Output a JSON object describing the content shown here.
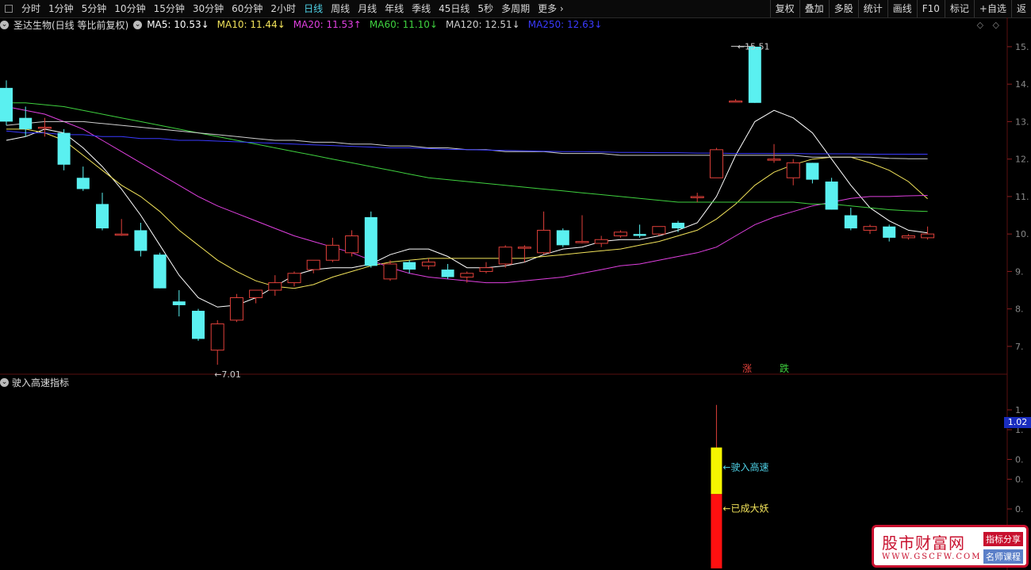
{
  "toolbar": {
    "periods": [
      {
        "label": "分时",
        "active": false
      },
      {
        "label": "1分钟",
        "active": false
      },
      {
        "label": "5分钟",
        "active": false
      },
      {
        "label": "10分钟",
        "active": false
      },
      {
        "label": "15分钟",
        "active": false
      },
      {
        "label": "30分钟",
        "active": false
      },
      {
        "label": "60分钟",
        "active": false
      },
      {
        "label": "2小时",
        "active": false
      },
      {
        "label": "日线",
        "active": true
      },
      {
        "label": "周线",
        "active": false
      },
      {
        "label": "月线",
        "active": false
      },
      {
        "label": "年线",
        "active": false
      },
      {
        "label": "季线",
        "active": false
      },
      {
        "label": "45日线",
        "active": false
      },
      {
        "label": "5秒",
        "active": false
      },
      {
        "label": "多周期",
        "active": false
      },
      {
        "label": "更多 ›",
        "active": false
      }
    ],
    "right_buttons": [
      "复权",
      "叠加",
      "多股",
      "统计",
      "画线",
      "F10",
      "标记",
      "+自选",
      "返"
    ]
  },
  "main_header": {
    "title": "圣达生物(日线 等比前复权)",
    "ma": [
      {
        "label": "MA5: 10.53↓",
        "color": "#ffffff"
      },
      {
        "label": "MA10: 11.44↓",
        "color": "#f2e35a"
      },
      {
        "label": "MA20: 11.53↑",
        "color": "#e040e0"
      },
      {
        "label": "MA60: 11.10↓",
        "color": "#3fd13f"
      },
      {
        "label": "MA120: 12.51↓",
        "color": "#cfcfcf"
      },
      {
        "label": "MA250: 12.63↓",
        "color": "#3a3aff"
      }
    ]
  },
  "price_axis": [
    "15.",
    "14.",
    "13.",
    "12.",
    "11.",
    "10.",
    "9.",
    "8.",
    "7."
  ],
  "annotations": {
    "high": "15.51",
    "low": "7.01",
    "zhang": "涨",
    "die": "跌"
  },
  "sub_header": {
    "title": "驶入高速指标"
  },
  "sub_axis": [
    "1.",
    "1.",
    "0.",
    "0.",
    "0.",
    "0."
  ],
  "sub_current": "1.02",
  "sub_labels": {
    "yellow": "驶入高速",
    "red": "已成大妖"
  },
  "colors": {
    "up": "#e0403a",
    "down": "#5af0f0",
    "ma5": "#ffffff",
    "ma10": "#f2e35a",
    "ma20": "#e040e0",
    "ma60": "#3fd13f",
    "ma120": "#cfcfcf",
    "ma250": "#3a3aff"
  },
  "watermark": {
    "name": "股市财富网",
    "url": "WWW.GSCFW.COM",
    "tag1": "指标分享",
    "tag2": "名师课程"
  },
  "chart_data": {
    "type": "candlestick",
    "candles": [
      {
        "o": 14.4,
        "h": 14.6,
        "l": 13.4,
        "c": 13.5
      },
      {
        "o": 13.6,
        "h": 13.9,
        "l": 13.1,
        "c": 13.3
      },
      {
        "o": 13.35,
        "h": 13.6,
        "l": 13.1,
        "c": 13.35
      },
      {
        "o": 13.2,
        "h": 13.3,
        "l": 12.2,
        "c": 12.35
      },
      {
        "o": 12.0,
        "h": 12.3,
        "l": 11.65,
        "c": 11.7
      },
      {
        "o": 11.3,
        "h": 11.6,
        "l": 10.6,
        "c": 10.65
      },
      {
        "o": 10.5,
        "h": 10.9,
        "l": 10.45,
        "c": 10.5
      },
      {
        "o": 10.6,
        "h": 10.8,
        "l": 9.9,
        "c": 10.05
      },
      {
        "o": 9.95,
        "h": 10.0,
        "l": 9.05,
        "c": 9.05
      },
      {
        "o": 8.7,
        "h": 9.0,
        "l": 8.3,
        "c": 8.6
      },
      {
        "o": 8.45,
        "h": 8.5,
        "l": 7.65,
        "c": 7.7
      },
      {
        "o": 7.4,
        "h": 8.2,
        "l": 7.01,
        "c": 8.1
      },
      {
        "o": 8.2,
        "h": 8.9,
        "l": 8.15,
        "c": 8.8
      },
      {
        "o": 8.8,
        "h": 9.0,
        "l": 8.65,
        "c": 9.0
      },
      {
        "o": 9.0,
        "h": 9.4,
        "l": 8.85,
        "c": 9.2
      },
      {
        "o": 9.2,
        "h": 9.5,
        "l": 9.1,
        "c": 9.45
      },
      {
        "o": 9.55,
        "h": 9.8,
        "l": 9.45,
        "c": 9.8
      },
      {
        "o": 9.8,
        "h": 10.4,
        "l": 9.75,
        "c": 10.2
      },
      {
        "o": 10.0,
        "h": 10.6,
        "l": 9.9,
        "c": 10.45
      },
      {
        "o": 10.95,
        "h": 11.1,
        "l": 9.6,
        "c": 9.65
      },
      {
        "o": 9.3,
        "h": 9.8,
        "l": 9.25,
        "c": 9.7
      },
      {
        "o": 9.75,
        "h": 9.8,
        "l": 9.45,
        "c": 9.55
      },
      {
        "o": 9.65,
        "h": 9.85,
        "l": 9.55,
        "c": 9.75
      },
      {
        "o": 9.55,
        "h": 9.7,
        "l": 9.3,
        "c": 9.35
      },
      {
        "o": 9.35,
        "h": 9.5,
        "l": 9.2,
        "c": 9.45
      },
      {
        "o": 9.5,
        "h": 9.75,
        "l": 9.45,
        "c": 9.6
      },
      {
        "o": 9.7,
        "h": 10.2,
        "l": 9.6,
        "c": 10.15
      },
      {
        "o": 10.15,
        "h": 10.2,
        "l": 9.75,
        "c": 10.15
      },
      {
        "o": 10.0,
        "h": 11.1,
        "l": 9.95,
        "c": 10.6
      },
      {
        "o": 10.6,
        "h": 10.65,
        "l": 10.15,
        "c": 10.2
      },
      {
        "o": 10.3,
        "h": 11.0,
        "l": 10.25,
        "c": 10.3
      },
      {
        "o": 10.25,
        "h": 10.45,
        "l": 10.15,
        "c": 10.35
      },
      {
        "o": 10.45,
        "h": 10.6,
        "l": 10.4,
        "c": 10.55
      },
      {
        "o": 10.5,
        "h": 10.75,
        "l": 10.4,
        "c": 10.45
      },
      {
        "o": 10.5,
        "h": 10.7,
        "l": 10.45,
        "c": 10.7
      },
      {
        "o": 10.8,
        "h": 10.85,
        "l": 10.55,
        "c": 10.65
      },
      {
        "o": 11.5,
        "h": 11.6,
        "l": 11.35,
        "c": 11.5
      },
      {
        "o": 12.0,
        "h": 12.8,
        "l": 12.0,
        "c": 12.75
      },
      {
        "o": 14.05,
        "h": 14.1,
        "l": 14.05,
        "c": 14.05
      },
      {
        "o": 15.5,
        "h": 15.51,
        "l": 14.0,
        "c": 14.0
      },
      {
        "o": 12.5,
        "h": 12.9,
        "l": 12.4,
        "c": 12.5
      },
      {
        "o": 12.0,
        "h": 12.5,
        "l": 11.8,
        "c": 12.4
      },
      {
        "o": 12.4,
        "h": 12.4,
        "l": 11.85,
        "c": 11.95
      },
      {
        "o": 11.9,
        "h": 12.0,
        "l": 11.15,
        "c": 11.15
      },
      {
        "o": 11.0,
        "h": 11.2,
        "l": 10.6,
        "c": 10.65
      },
      {
        "o": 10.6,
        "h": 10.75,
        "l": 10.5,
        "c": 10.7
      },
      {
        "o": 10.7,
        "h": 10.75,
        "l": 10.3,
        "c": 10.4
      },
      {
        "o": 10.4,
        "h": 10.5,
        "l": 10.35,
        "c": 10.45
      },
      {
        "o": 10.4,
        "h": 10.7,
        "l": 10.35,
        "c": 10.5
      }
    ],
    "ma_series": [
      {
        "name": "MA5",
        "values": [
          13.0,
          13.1,
          13.3,
          13.2,
          12.8,
          12.3,
          11.7,
          11.0,
          10.2,
          9.4,
          8.8,
          8.55,
          8.6,
          8.8,
          9.1,
          9.4,
          9.55,
          9.6,
          9.6,
          9.7,
          9.95,
          10.1,
          10.1,
          9.9,
          9.6,
          9.6,
          9.65,
          9.75,
          9.95,
          10.1,
          10.15,
          10.3,
          10.35,
          10.35,
          10.45,
          10.6,
          10.8,
          11.5,
          12.6,
          13.5,
          13.8,
          13.6,
          13.2,
          12.5,
          11.8,
          11.2,
          10.85,
          10.6,
          10.53
        ]
      },
      {
        "name": "MA10",
        "values": [
          13.3,
          13.3,
          13.2,
          13.0,
          12.6,
          12.2,
          11.8,
          11.5,
          11.1,
          10.6,
          10.2,
          9.8,
          9.5,
          9.25,
          9.1,
          9.05,
          9.15,
          9.35,
          9.5,
          9.65,
          9.75,
          9.8,
          9.85,
          9.85,
          9.85,
          9.85,
          9.85,
          9.85,
          9.9,
          9.95,
          10.0,
          10.05,
          10.1,
          10.2,
          10.3,
          10.45,
          10.6,
          10.9,
          11.3,
          11.8,
          12.15,
          12.35,
          12.5,
          12.55,
          12.55,
          12.4,
          12.2,
          11.9,
          11.44
        ]
      },
      {
        "name": "MA20",
        "values": [
          13.9,
          13.8,
          13.7,
          13.5,
          13.3,
          13.0,
          12.7,
          12.4,
          12.1,
          11.8,
          11.5,
          11.25,
          11.05,
          10.85,
          10.65,
          10.45,
          10.3,
          10.15,
          10.0,
          9.8,
          9.6,
          9.45,
          9.35,
          9.3,
          9.25,
          9.2,
          9.2,
          9.25,
          9.3,
          9.35,
          9.45,
          9.55,
          9.65,
          9.7,
          9.8,
          9.9,
          10.0,
          10.15,
          10.45,
          10.75,
          10.95,
          11.1,
          11.25,
          11.35,
          11.45,
          11.5,
          11.5,
          11.52,
          11.53
        ]
      },
      {
        "name": "MA60",
        "values": [
          14.0,
          14.0,
          13.95,
          13.9,
          13.8,
          13.7,
          13.6,
          13.5,
          13.4,
          13.3,
          13.2,
          13.1,
          13.0,
          12.9,
          12.8,
          12.7,
          12.6,
          12.5,
          12.4,
          12.3,
          12.2,
          12.1,
          12.0,
          11.95,
          11.9,
          11.85,
          11.8,
          11.75,
          11.7,
          11.65,
          11.6,
          11.55,
          11.5,
          11.45,
          11.4,
          11.35,
          11.35,
          11.35,
          11.35,
          11.35,
          11.35,
          11.35,
          11.3,
          11.3,
          11.25,
          11.2,
          11.15,
          11.12,
          11.1
        ]
      },
      {
        "name": "MA120",
        "values": [
          13.4,
          13.45,
          13.5,
          13.5,
          13.5,
          13.45,
          13.4,
          13.35,
          13.3,
          13.25,
          13.2,
          13.15,
          13.1,
          13.05,
          13.0,
          13.0,
          12.95,
          12.95,
          12.9,
          12.9,
          12.85,
          12.85,
          12.8,
          12.8,
          12.75,
          12.75,
          12.7,
          12.7,
          12.7,
          12.65,
          12.65,
          12.65,
          12.6,
          12.6,
          12.6,
          12.6,
          12.6,
          12.6,
          12.6,
          12.6,
          12.6,
          12.6,
          12.55,
          12.55,
          12.55,
          12.55,
          12.52,
          12.51,
          12.51
        ]
      },
      {
        "name": "MA250",
        "values": [
          13.25,
          13.2,
          13.2,
          13.15,
          13.15,
          13.1,
          13.1,
          13.05,
          13.05,
          13.0,
          13.0,
          12.98,
          12.96,
          12.94,
          12.92,
          12.9,
          12.88,
          12.86,
          12.84,
          12.82,
          12.8,
          12.8,
          12.78,
          12.76,
          12.75,
          12.74,
          12.73,
          12.72,
          12.71,
          12.7,
          12.7,
          12.69,
          12.68,
          12.68,
          12.67,
          12.67,
          12.66,
          12.66,
          12.65,
          12.65,
          12.65,
          12.65,
          12.64,
          12.64,
          12.64,
          12.63,
          12.63,
          12.63,
          12.63
        ]
      }
    ],
    "ylim": [
      6.8,
      15.9
    ],
    "indicator": {
      "bars": [
        {
          "index": 37,
          "top_value": 1.45,
          "yellow_top": 1.02,
          "yellow_bottom": 0.55,
          "red_bottom": -0.2
        }
      ],
      "ylim": [
        -0.2,
        1.6
      ]
    }
  }
}
